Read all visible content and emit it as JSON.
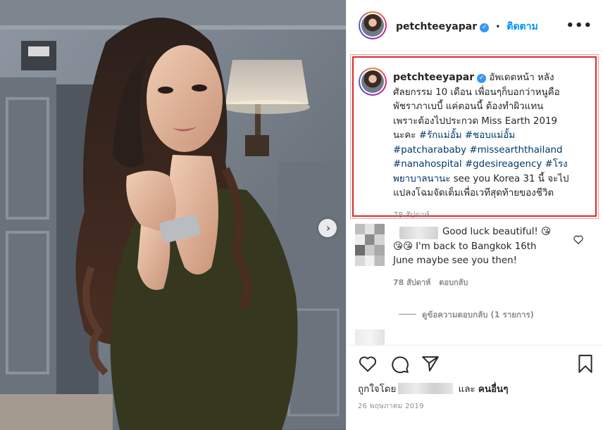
{
  "post": {
    "username": "petchteeyapar",
    "verified_mark": "✓",
    "separator": "•",
    "follow_label": "ติดตาม",
    "more_label": "•••",
    "next_arrow": "›"
  },
  "caption": {
    "username": "petchteeyapar",
    "text_lines": [
      "อัพเดตหน้า หลัง",
      "ศัลยกรรม 10 เดือน เพื่อนๆก็บอกว่าหนูคือ",
      "พัชราภาเบบี้ แค่ตอนนี้ ต้องทำผิวแทน",
      "เพราะต้องไปประกวด Miss Earth 2019"
    ],
    "line5_text": "นะคะ ",
    "tags": [
      "#รักแม่อั้ม",
      "#ชอบแม่อั้ม",
      "#patcharababy",
      "#missearththailand",
      "#nanahospital",
      "#gdesireagency",
      "#โรง",
      "พยาบาลนานะ"
    ],
    "after_tags": " see you Korea 31 นี้ จะไป",
    "last_line": "แปลงโฉมจัดเต็มเพื่อเวทีสุดท้ายของชีวิต",
    "age": "78 สัปดาห์"
  },
  "comment": {
    "line1": "Good luck beautiful! 😘",
    "line2": "😘😘 I'm back to Bangkok 16th",
    "line3": "June maybe see you then!",
    "age": "78 สัปดาห์",
    "reply_label": "ตอบกลับ",
    "view_replies": "ดูข้อความตอบกลับ (1 รายการ)"
  },
  "actions": {
    "liked_by_prefix": "ถูกใจโดย",
    "liked_by_and": "และ",
    "liked_by_others": "คนอื่นๆ",
    "date": "26 พฤษภาคม 2019"
  },
  "colors": {
    "link": "#00376b",
    "follow": "#0095f6",
    "highlight": "#e0262a",
    "meta": "#8e8e8e"
  }
}
